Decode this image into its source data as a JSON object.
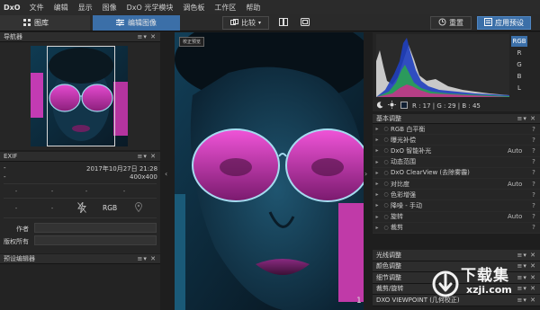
{
  "app": {
    "logo": "DxO"
  },
  "menu": [
    "文件",
    "编辑",
    "显示",
    "图像",
    "DxO 光学模块",
    "调色板",
    "工作区",
    "帮助"
  ],
  "toolbar": {
    "library_label": "图库",
    "edit_label": "编辑图像",
    "compare_label": "比较",
    "reset_label": "重置",
    "preset_label": "应用预设"
  },
  "navigator": {
    "title": "导航器",
    "controls": "≡▾ ✕"
  },
  "exif": {
    "title": "EXIF",
    "controls": "≡▾ ✕",
    "date": "2017年10月27日 21:28",
    "size": "400x400",
    "dash": "-",
    "cells": [
      "-",
      "-",
      "-",
      "-",
      "-",
      "-",
      "-",
      "-"
    ],
    "rgb_label": "RGB",
    "author_label": "作者",
    "copyright_label": "版权所有"
  },
  "preset_editor": {
    "title": "预设编辑器",
    "controls": "≡▾ ✕"
  },
  "histogram": {
    "channels": [
      "RGB",
      "R",
      "G",
      "B",
      "L"
    ],
    "readout": "R : 17 | G : 29 | B : 45"
  },
  "basic": {
    "title": "基本调整",
    "controls": "≡▾ ✕",
    "items": [
      {
        "label": "RGB 白平衡",
        "value": "",
        "help": "?"
      },
      {
        "label": "曝光补偿",
        "value": "",
        "help": "?"
      },
      {
        "label": "DxO 智能补光",
        "value": "Auto",
        "help": "?"
      },
      {
        "label": "动态范围",
        "value": "",
        "help": "?"
      },
      {
        "label": "DxO ClearView (去除雾霾)",
        "value": "",
        "help": "?"
      },
      {
        "label": "对比度",
        "value": "Auto",
        "help": "?"
      },
      {
        "label": "色彩增强",
        "value": "",
        "help": "?"
      },
      {
        "label": "降噪 - 手动",
        "value": "",
        "help": "?"
      },
      {
        "label": "旋转",
        "value": "Auto",
        "help": "?"
      },
      {
        "label": "裁剪",
        "value": "",
        "help": "?"
      }
    ]
  },
  "categories": [
    {
      "label": "光线调整",
      "controls": "≡▾ ✕"
    },
    {
      "label": "颜色调整",
      "controls": "≡▾ ✕"
    },
    {
      "label": "细节调整",
      "controls": "≡▾ ✕"
    },
    {
      "label": "裁剪/旋转",
      "controls": "≡▾ ✕"
    },
    {
      "label": "DXO VIEWPOINT (几何校正)",
      "controls": "≡▾ ✕"
    }
  ],
  "image": {
    "badge": "校正预览",
    "page_mark": "1"
  },
  "watermark": {
    "title": "下载集",
    "url": "xzji.com"
  },
  "colors": {
    "accent": "#3b6fa8",
    "panel": "#262626",
    "header": "#2d2d2d"
  }
}
